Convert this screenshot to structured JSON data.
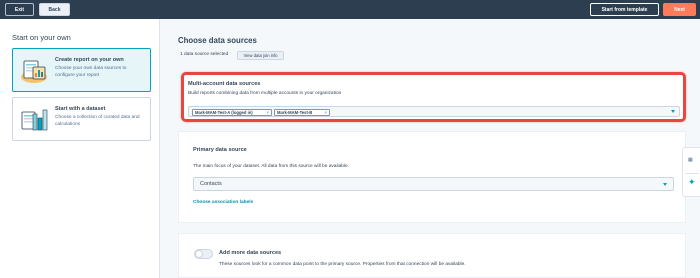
{
  "topbar": {
    "exit_label": "Exit",
    "back_label": "Back",
    "template_label": "Start from template",
    "next_label": "Next"
  },
  "left_panel": {
    "title": "Start on your own",
    "cards": [
      {
        "title": "Create report on your own",
        "description": "Choose your own data sources to configure your report",
        "selected": true
      },
      {
        "title": "Start with a dataset",
        "description": "Choose a collection of curated data and calculations",
        "selected": false
      }
    ]
  },
  "main": {
    "title": "Choose data sources",
    "selected_count": "1 data source selected",
    "join_info_button": "View data join info",
    "multi_account": {
      "title": "Multi-account data sources",
      "description": "Build reports combining data from multiple accounts in your organization",
      "tags": [
        "Mark-MAM-Test-A (logged in)",
        "Mark-MAM-Test-B"
      ]
    },
    "primary": {
      "title": "Primary data source",
      "description": "The main focus of your dataset. All data from this source will be available.",
      "selected_value": "Contacts",
      "association_link": "Choose association labels"
    },
    "more_sources": {
      "title": "Add more data sources",
      "description": "These sources look for a common data point to the primary source. Properties from that connection will be available.",
      "toggle_on": false
    }
  },
  "side_widget": {
    "grid_icon_glyph": "▦",
    "spark_icon_glyph": "✦"
  },
  "colors": {
    "topbar": "#2d3e50",
    "accent_orange": "#ff7a59",
    "highlight_red": "#e8473f",
    "teal": "#00a4bd",
    "link": "#0091ae"
  }
}
